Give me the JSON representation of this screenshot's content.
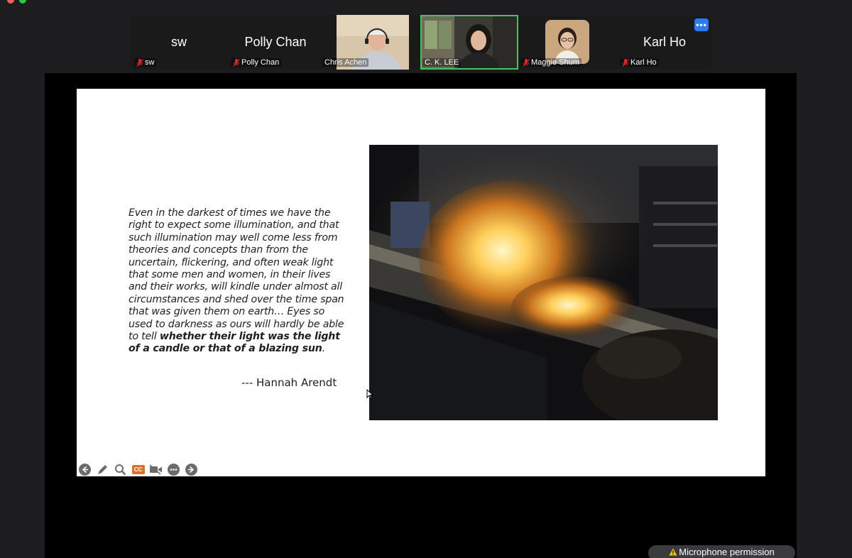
{
  "window": {
    "traffic_colors": [
      "#ff5f57",
      "#febc2e",
      "#28c840"
    ]
  },
  "gallery": {
    "participants": [
      {
        "big_name": "sw",
        "label": "sw",
        "muted": true
      },
      {
        "big_name": "Polly Chan",
        "label": "Polly Chan",
        "muted": true
      },
      {
        "label": "Chris Achen",
        "muted": false,
        "video": true
      },
      {
        "label": "C. K.  LEE",
        "muted": false,
        "video": true,
        "active_speaker": true
      },
      {
        "label": "Maggie Shum",
        "muted": true,
        "avatar": true
      },
      {
        "big_name": "Karl Ho",
        "label": "Karl Ho",
        "muted": true
      }
    ],
    "more_icon": "ellipsis-icon",
    "active_color": "#3cc763"
  },
  "slide": {
    "quote_part1": "Even in the darkest of times we have the right to expect some illumination, and that such illumination may well come less from theories and concepts than from the uncertain, flickering, and often weak light that some men and women, in their lives and their works, will kindle under almost all circumstances and shed over the time span that was given them on earth… Eyes so used to darkness as ours will hardly be able to tell ",
    "quote_bold": "whether their light was the light of a candle or that of a blazing sun",
    "quote_end": ".",
    "author": "--- Hannah Arendt"
  },
  "toolbar": {
    "icons": [
      "arrow-left-icon",
      "pen-icon",
      "magnifier-icon",
      "captions-icon",
      "video-off-icon",
      "more-icon",
      "arrow-right-icon"
    ],
    "cc_text": "CC",
    "cc_color": "#d9712c"
  },
  "status": {
    "mic_permission": "Microphone permission",
    "warning_icon": "warning-icon"
  }
}
